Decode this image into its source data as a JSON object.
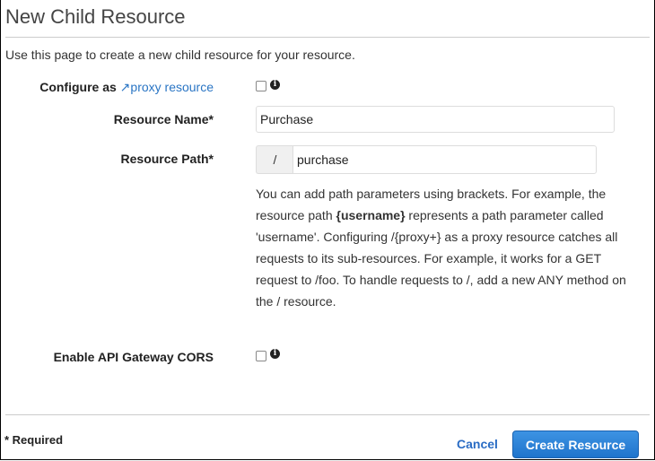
{
  "title": "New Child Resource",
  "intro": "Use this page to create a new child resource for your resource.",
  "proxy": {
    "label_prefix": "Configure as",
    "link": "proxy resource",
    "checked": false
  },
  "resource_name": {
    "label": "Resource Name*",
    "value": "Purchase"
  },
  "resource_path": {
    "label": "Resource Path*",
    "prefix": "/",
    "value": "purchase"
  },
  "help": {
    "part1": "You can add path parameters using brackets. For example, the resource path ",
    "bold": "{username}",
    "part2": " represents a path parameter called 'username'. Configuring /{proxy+} as a proxy resource catches all requests to its sub-resources. For example, it works for a GET request to /foo. To handle requests to /, add a new ANY method on the / resource."
  },
  "cors": {
    "label": "Enable API Gateway CORS",
    "checked": false
  },
  "footer": {
    "required": "* Required",
    "cancel": "Cancel",
    "create": "Create Resource"
  },
  "colors": {
    "link": "#2a75c4",
    "primary_button": "#2a7fd6"
  }
}
